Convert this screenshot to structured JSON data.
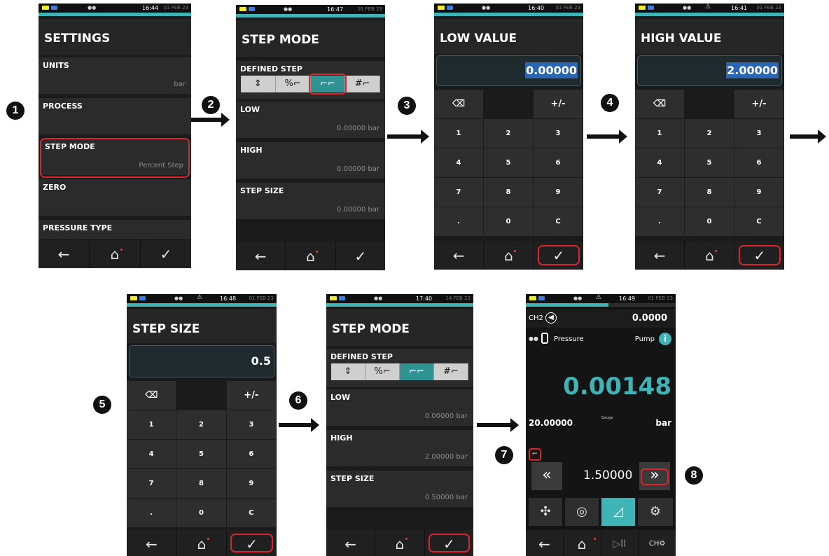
{
  "steps": [
    "1",
    "2",
    "3",
    "4",
    "5",
    "6",
    "7",
    "8"
  ],
  "screens": {
    "settings": {
      "status": {
        "time": "16:44",
        "date": "01 FEB 23"
      },
      "title": "SETTINGS",
      "items": [
        {
          "label": "UNITS",
          "value": "bar"
        },
        {
          "label": "PROCESS",
          "value": ""
        },
        {
          "label": "STEP MODE",
          "value": "Percent Step"
        },
        {
          "label": "ZERO",
          "value": ""
        },
        {
          "label": "PRESSURE TYPE",
          "value": ""
        }
      ]
    },
    "stepmode1": {
      "status": {
        "time": "16:47",
        "date": "01 FEB 23"
      },
      "title": "STEP MODE",
      "defined_step": "DEFINED STEP",
      "fields": [
        {
          "label": "LOW",
          "value": "0.00000 bar"
        },
        {
          "label": "HIGH",
          "value": "0.00000 bar"
        },
        {
          "label": "STEP SIZE",
          "value": "0.00000 bar"
        }
      ]
    },
    "low": {
      "status": {
        "time": "16:40",
        "date": "01 FEB 23"
      },
      "title": "LOW VALUE",
      "value": "0.00000"
    },
    "high": {
      "status": {
        "time": "16:41",
        "date": "01 FEB 23"
      },
      "title": "HIGH VALUE",
      "value": "2.00000"
    },
    "stepsize": {
      "status": {
        "time": "16:48",
        "date": "01 FEB 23"
      },
      "title": "STEP SIZE",
      "value": "0.5"
    },
    "stepmode2": {
      "status": {
        "time": "17:40",
        "date": "14 FEB 23"
      },
      "title": "STEP MODE",
      "defined_step": "DEFINED STEP",
      "fields": [
        {
          "label": "LOW",
          "value": "0.00000 bar"
        },
        {
          "label": "HIGH",
          "value": "2.00000 bar"
        },
        {
          "label": "STEP SIZE",
          "value": "0.50000 bar"
        }
      ]
    },
    "run": {
      "status": {
        "time": "16:49",
        "date": "01 FEB 23"
      },
      "channel": "CH2",
      "channel_value": "0.0000",
      "pressure_label": "Pressure",
      "pump_label": "Pump",
      "reading": "0.00148",
      "range": "20.00000",
      "gauge": "Gauge",
      "unit": "bar",
      "setpoint": "1.50000",
      "progress": 0.55
    }
  },
  "keypad": {
    "backspace": "⌫",
    "plusminus": "+/-",
    "keys": [
      "1",
      "2",
      "3",
      "4",
      "5",
      "6",
      "7",
      "8",
      "9",
      ".",
      "0",
      "C"
    ]
  },
  "icons": {
    "back": "←",
    "home": "⌂",
    "check": "✓"
  },
  "colors": {
    "teal": "#3fb3b5",
    "highlight": "#d9252b",
    "select": "#2b66b4"
  }
}
